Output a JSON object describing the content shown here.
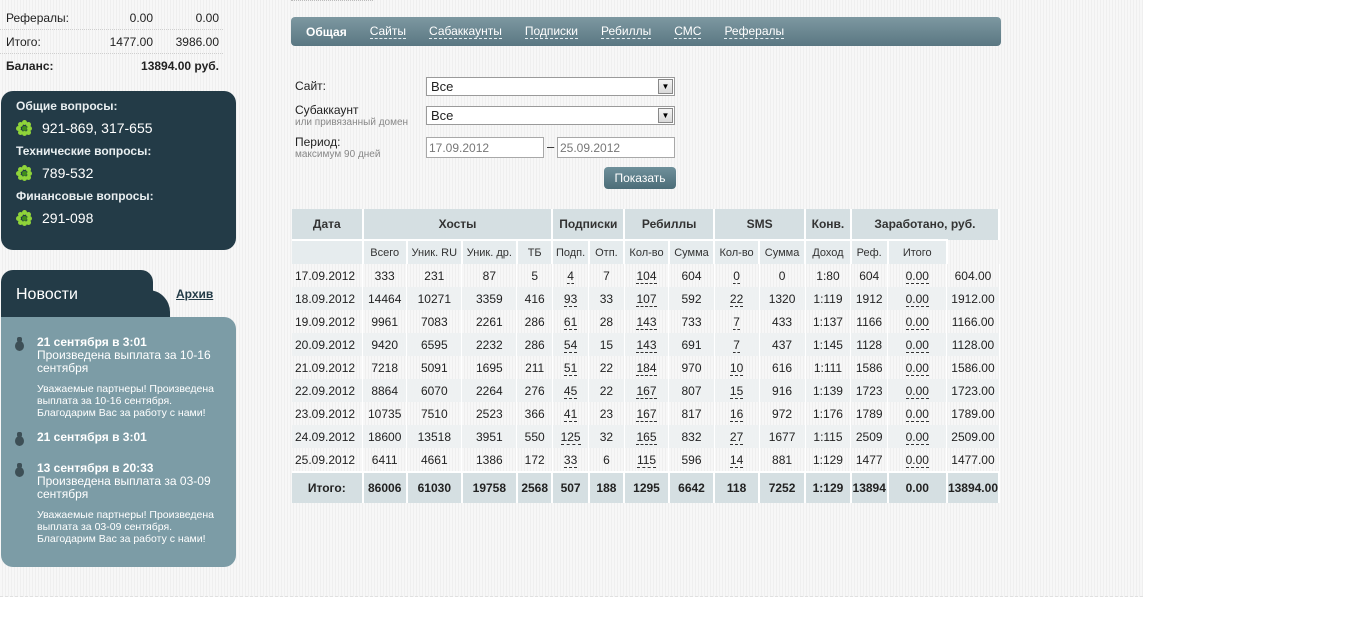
{
  "balance": {
    "rows": [
      {
        "label": "Рефералы:",
        "v1": "0.00",
        "v2": "0.00"
      },
      {
        "label": "Итого:",
        "v1": "1477.00",
        "v2": "3986.00"
      }
    ],
    "total_label": "Баланс:",
    "total_value": "13894.00 руб."
  },
  "support": {
    "general_label": "Общие вопросы:",
    "general_icq": "921-869, 317-655",
    "tech_label": "Технические вопросы:",
    "tech_icq": "789-532",
    "finance_label": "Финансовые вопросы:",
    "finance_icq": "291-098",
    "icon": "icq-flower-icon"
  },
  "news": {
    "title": "Новости",
    "archive": "Архив",
    "items": [
      {
        "date": "21 сентября в 3:01",
        "head": "Произведена выплата за 10-16 сентября",
        "text": "Уважаемые партнеры! Произведена выплата за 10-16 сентября. Благодарим Вас за работу с нами!"
      },
      {
        "date": "21 сентября в 3:01",
        "head": "",
        "text": ""
      },
      {
        "date": "13 сентября в 20:33",
        "head": "Произведена выплата за 03-09 сентября",
        "text": "Уважаемые партнеры! Произведена выплата за 03-09 сентября. Благодарим Вас за работу с нами!"
      }
    ]
  },
  "tabs": [
    "Общая",
    "Сайты",
    "Сабаккаунты",
    "Подписки",
    "Ребиллы",
    "СМС",
    "Рефералы"
  ],
  "filter": {
    "site_label": "Сайт:",
    "site_value": "Все",
    "sub_label": "Субаккаунт",
    "sub_hint": "или привязанный домен",
    "sub_value": "Все",
    "period_label": "Период:",
    "period_hint": "максимум 90 дней",
    "date_from": "17.09.2012",
    "date_to": "25.09.2012",
    "dash": "–",
    "show_button": "Показать"
  },
  "table": {
    "group_headers": [
      "Дата",
      "Хосты",
      "Подписки",
      "Ребиллы",
      "SMS",
      "Конв.",
      "Заработано, руб."
    ],
    "sub_headers": [
      "Всего",
      "Уник. RU",
      "Уник. др.",
      "ТБ",
      "Подп.",
      "Отп.",
      "Кол-во",
      "Сумма",
      "Кол-во",
      "Сумма",
      "Доход",
      "Реф.",
      "Итого"
    ],
    "rows": [
      [
        "17.09.2012",
        "333",
        "231",
        "87",
        "5",
        "4",
        "7",
        "104",
        "604",
        "0",
        "0",
        "1:80",
        "604",
        "0.00",
        "604.00"
      ],
      [
        "18.09.2012",
        "14464",
        "10271",
        "3359",
        "416",
        "93",
        "33",
        "107",
        "592",
        "22",
        "1320",
        "1:119",
        "1912",
        "0.00",
        "1912.00"
      ],
      [
        "19.09.2012",
        "9961",
        "7083",
        "2261",
        "286",
        "61",
        "28",
        "143",
        "733",
        "7",
        "433",
        "1:137",
        "1166",
        "0.00",
        "1166.00"
      ],
      [
        "20.09.2012",
        "9420",
        "6595",
        "2232",
        "286",
        "54",
        "15",
        "143",
        "691",
        "7",
        "437",
        "1:145",
        "1128",
        "0.00",
        "1128.00"
      ],
      [
        "21.09.2012",
        "7218",
        "5091",
        "1695",
        "211",
        "51",
        "22",
        "184",
        "970",
        "10",
        "616",
        "1:111",
        "1586",
        "0.00",
        "1586.00"
      ],
      [
        "22.09.2012",
        "8864",
        "6070",
        "2264",
        "276",
        "45",
        "22",
        "167",
        "807",
        "15",
        "916",
        "1:139",
        "1723",
        "0.00",
        "1723.00"
      ],
      [
        "23.09.2012",
        "10735",
        "7510",
        "2523",
        "366",
        "41",
        "23",
        "167",
        "817",
        "16",
        "972",
        "1:176",
        "1789",
        "0.00",
        "1789.00"
      ],
      [
        "24.09.2012",
        "18600",
        "13518",
        "3951",
        "550",
        "125",
        "32",
        "165",
        "832",
        "27",
        "1677",
        "1:115",
        "2509",
        "0.00",
        "2509.00"
      ],
      [
        "25.09.2012",
        "6411",
        "4661",
        "1386",
        "172",
        "33",
        "6",
        "115",
        "596",
        "14",
        "881",
        "1:129",
        "1477",
        "0.00",
        "1477.00"
      ]
    ],
    "total": [
      "Итого:",
      "86006",
      "61030",
      "19758",
      "2568",
      "507",
      "188",
      "1295",
      "6642",
      "118",
      "7252",
      "1:129",
      "13894",
      "0.00",
      "13894.00"
    ]
  }
}
